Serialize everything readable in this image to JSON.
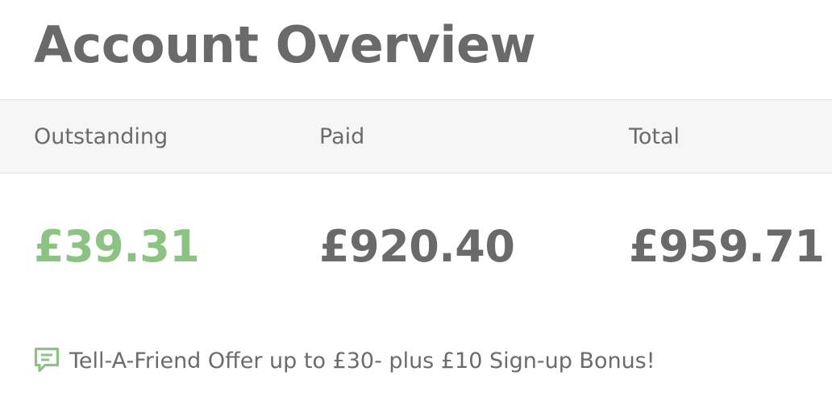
{
  "page_title": "Account Overview",
  "columns": [
    {
      "label": "Outstanding",
      "amount": "£39.31"
    },
    {
      "label": "Paid",
      "amount": "£920.40"
    },
    {
      "label": "Total",
      "amount": "£959.71"
    }
  ],
  "colors": {
    "outstanding_amount": "#8cc383",
    "text": "#6b6b6b",
    "header_band": "#f5f6f5",
    "promo_icon": "#8cc383"
  },
  "promo": {
    "icon": "speech-bubble-icon",
    "text": "Tell-A-Friend Offer up to £30- plus £10 Sign-up Bonus!"
  }
}
